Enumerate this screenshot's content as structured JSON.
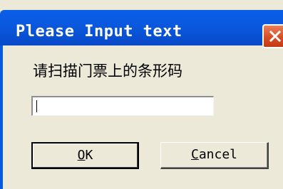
{
  "window": {
    "title": "Please Input text",
    "close_icon": "close-x"
  },
  "prompt": {
    "label": "请扫描门票上的条形码"
  },
  "input": {
    "value": "",
    "placeholder": ""
  },
  "buttons": {
    "ok": {
      "mnemonic": "O",
      "rest": "K"
    },
    "cancel": {
      "mnemonic": "C",
      "rest": "ancel"
    }
  },
  "colors": {
    "title_bar": "#0a58de",
    "close_button": "#d94d25",
    "dialog_face": "#ece9d8"
  }
}
